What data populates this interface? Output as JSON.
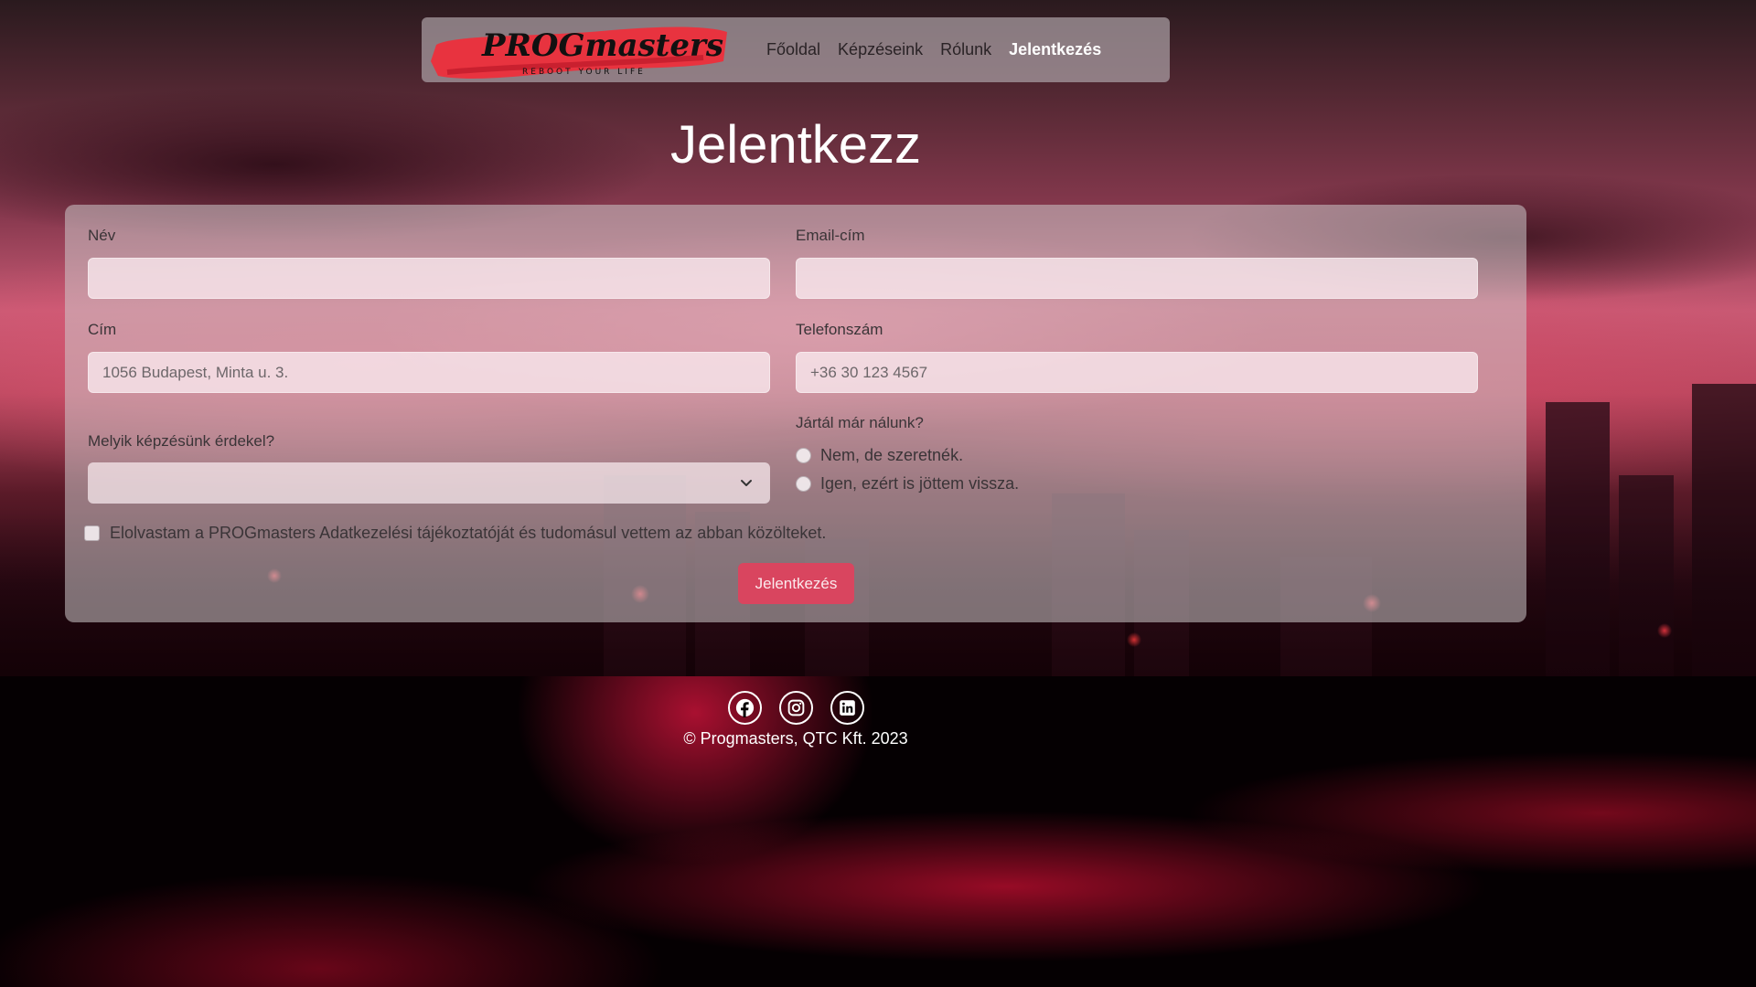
{
  "brand": {
    "name": "PROGmasters",
    "tagline": "REBOOT YOUR LIFE",
    "accent_color": "#d9455f"
  },
  "nav": {
    "items": [
      {
        "label": "Főoldal",
        "active": false
      },
      {
        "label": "Képzéseink",
        "active": false
      },
      {
        "label": "Rólunk",
        "active": false
      },
      {
        "label": "Jelentkezés",
        "active": true
      }
    ]
  },
  "page": {
    "title": "Jelentkezz"
  },
  "form": {
    "name_label": "Név",
    "name_value": "",
    "email_label": "Email-cím",
    "email_value": "",
    "address_label": "Cím",
    "address_placeholder": "1056 Budapest, Minta u. 3.",
    "phone_label": "Telefonszám",
    "phone_placeholder": "+36 30 123 4567",
    "course_label": "Melyik képzésünk érdekel?",
    "course_selected": "",
    "visited_label": "Jártál már nálunk?",
    "visited_options": [
      {
        "label": "Nem, de szeretnék.",
        "checked": false
      },
      {
        "label": "Igen, ezért is jöttem vissza.",
        "checked": false
      }
    ],
    "consent_label": "Elolvastam a PROGmasters Adatkezelési tájékoztatóját és tudomásul vettem az abban közölteket.",
    "consent_checked": false,
    "submit_label": "Jelentkezés"
  },
  "footer": {
    "social_icons": [
      "facebook-icon",
      "instagram-icon",
      "linkedin-icon"
    ],
    "copyright": "© Progmasters, QTC Kft. 2023"
  }
}
